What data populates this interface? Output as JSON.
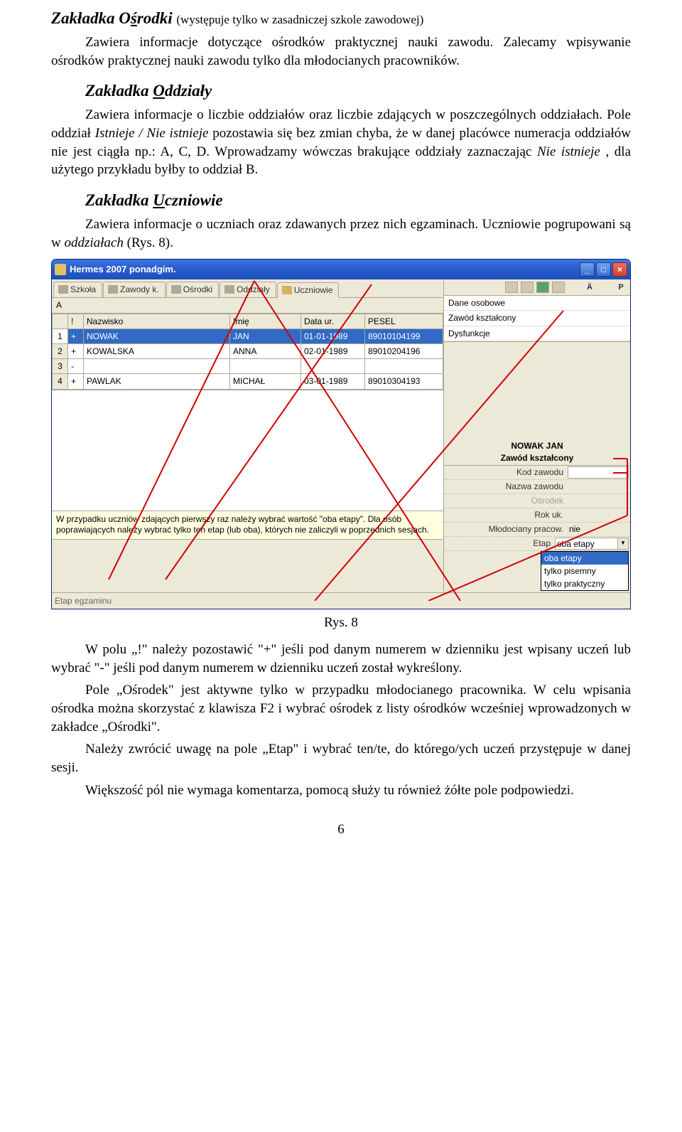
{
  "sections": {
    "osrodki": {
      "heading_pre": "Zakładka ",
      "heading_word_pre": "O",
      "heading_word_u": "ś",
      "heading_word_post": "rodki",
      "heading_paren": " (występuje tylko w zasadniczej szkole zawodowej)",
      "p1": "Zawiera informacje dotyczące ośrodków praktycznej nauki zawodu. Zalecamy wpisywanie ośrodków praktycznej nauki zawodu tylko dla młodocianych pracowników."
    },
    "oddzialy": {
      "heading_pre": "Zakładka ",
      "heading_word_u": "O",
      "heading_word_post": "ddziały",
      "p1_a": "Zawiera informacje o liczbie oddziałów oraz liczbie zdających w poszczególnych oddziałach. Pole oddział ",
      "p1_b": "Istnieje / Nie istnieje",
      "p1_c": " pozostawia się bez zmian chyba, że w danej placówce numeracja oddziałów nie jest ciągła np.: A, C, D. Wprowadzamy wówczas brakujące oddziały zaznaczając ",
      "p1_d": "Nie istnieje",
      "p1_e": ", dla użytego przykładu byłby to oddział B."
    },
    "uczniowie": {
      "heading_pre": "Zakładka ",
      "heading_word_u": "U",
      "heading_word_post": "czniowie",
      "p1_a": "Zawiera informacje o uczniach oraz zdawanych przez nich egzaminach. Uczniowie pogrupowani są w ",
      "p1_b": "oddziałach",
      "p1_c": " (Rys. 8)."
    }
  },
  "app": {
    "title": "Hermes 2007 ponadgim.",
    "tabs": [
      "Szkoła",
      "Zawody k.",
      "Ośrodki",
      "Oddziały",
      "Uczniowie"
    ],
    "active_tab": 4,
    "group_label": "A",
    "table": {
      "headers": [
        "",
        "!",
        "Nazwisko",
        "Imię",
        "Data ur.",
        "PESEL"
      ],
      "rows": [
        {
          "n": "1",
          "mark": "+",
          "nazwisko": "NOWAK",
          "imie": "JAN",
          "data": "01-01-1989",
          "pesel": "89010104199",
          "selected": true
        },
        {
          "n": "2",
          "mark": "+",
          "nazwisko": "KOWALSKA",
          "imie": "ANNA",
          "data": "02-01-1989",
          "pesel": "89010204196",
          "selected": false
        },
        {
          "n": "3",
          "mark": "-",
          "nazwisko": "",
          "imie": "",
          "data": "",
          "pesel": "",
          "selected": false
        },
        {
          "n": "4",
          "mark": "+",
          "nazwisko": "PAWLAK",
          "imie": "MICHAŁ",
          "data": "03-01-1989",
          "pesel": "89010304193",
          "selected": false
        }
      ]
    },
    "hint": "W przypadku uczniów zdających pierwszy raz należy wybrać wartość \"oba etapy\". Dla osób poprawiających należy wybrać tylko ten etap (lub oba), których nie zaliczyli w poprzednich sesjach.",
    "footer": "Etap egzaminu",
    "toolbar_text": [
      "Ä",
      "P"
    ],
    "side_categories": [
      "Dane osobowe",
      "Zawód kształcony",
      "Dysfunkcje"
    ],
    "detail": {
      "student": "NOWAK JAN",
      "sub": "Zawód kształcony",
      "fields": {
        "kod": {
          "label": "Kod zawodu",
          "value": ""
        },
        "nazwa": {
          "label": "Nazwa zawodu",
          "value": ""
        },
        "osrodek": {
          "label": "Ośrodek",
          "value": ""
        },
        "rok": {
          "label": "Rok uk.",
          "value": ""
        },
        "mlodoc": {
          "label": "Młodociany pracow.",
          "value": "nie"
        },
        "etap": {
          "label": "Etap",
          "value": "oba etapy"
        }
      },
      "dropdown": [
        "oba etapy",
        "tylko pisemny",
        "tylko praktyczny"
      ]
    }
  },
  "fig_caption": "Rys. 8",
  "body_after": {
    "p1": "W polu „!\" należy pozostawić \"+\" jeśli pod danym numerem w dzienniku jest wpisany uczeń lub wybrać \"-\" jeśli pod danym numerem w dzienniku uczeń został wykreślony.",
    "p2": "Pole „Ośrodek\" jest aktywne tylko w przypadku młodocianego pracownika. W celu wpisania ośrodka można skorzystać z klawisza F2 i wybrać ośrodek z listy ośrodków wcześniej wprowadzonych w zakładce „Ośrodki\".",
    "p3": "Należy zwrócić uwagę na pole „Etap\" i wybrać ten/te, do którego/ych uczeń przystępuje w danej sesji.",
    "p4": "Większość pól nie wymaga komentarza, pomocą służy tu również żółte pole podpowiedzi."
  },
  "page_number": "6"
}
